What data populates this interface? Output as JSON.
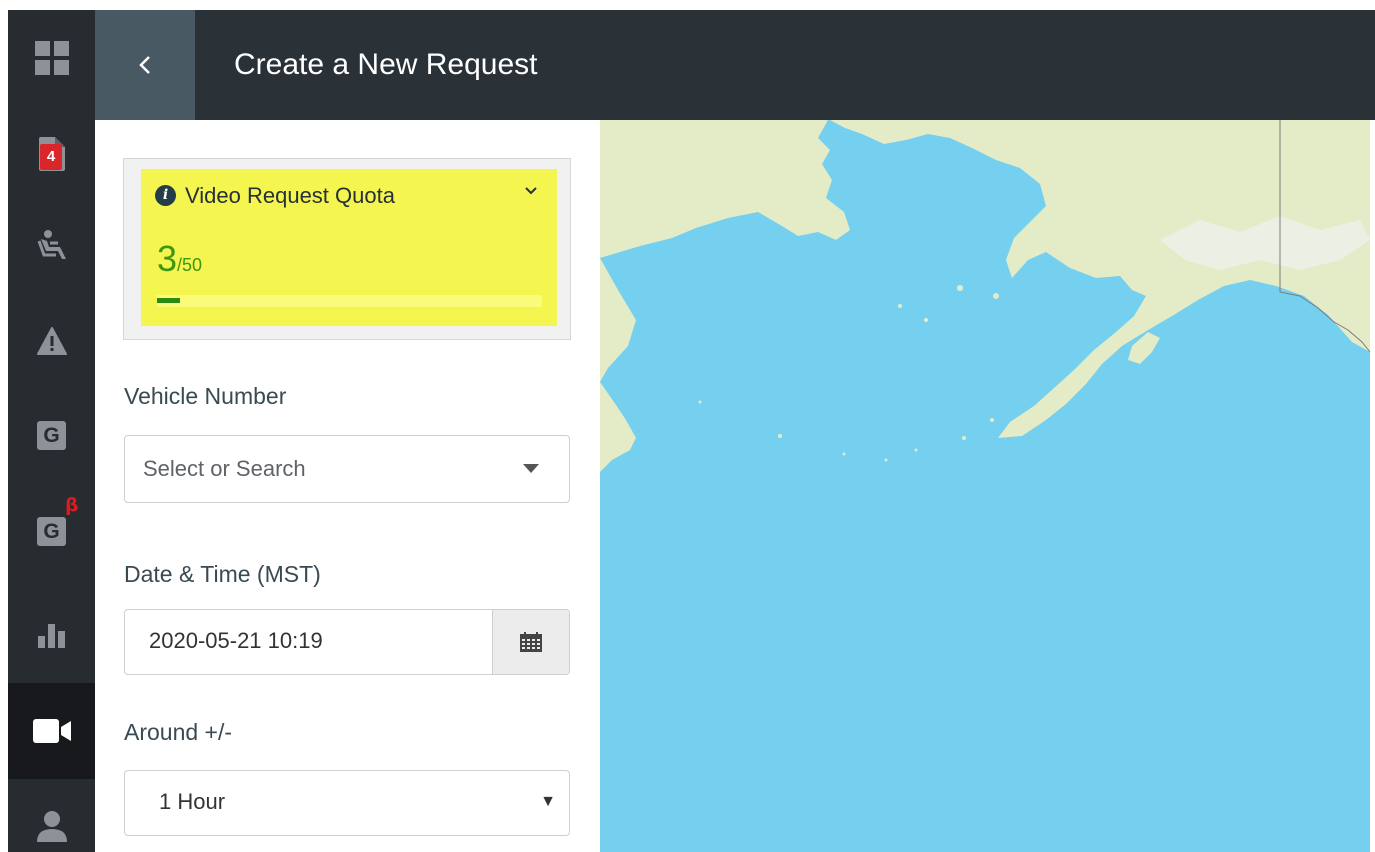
{
  "header": {
    "back_icon": "chevron-left-icon",
    "title": "Create a New Request"
  },
  "sidebar": {
    "items": [
      {
        "icon": "dashboard-grid-icon"
      },
      {
        "icon": "document-icon",
        "badge": "4"
      },
      {
        "icon": "driver-seat-icon"
      },
      {
        "icon": "warning-icon"
      },
      {
        "icon": "geofence-icon",
        "letter": "G"
      },
      {
        "icon": "geofence-beta-icon",
        "letter": "G",
        "superscript": "β"
      },
      {
        "icon": "bar-chart-icon"
      },
      {
        "icon": "video-camera-icon",
        "active": true
      },
      {
        "icon": "user-icon"
      }
    ]
  },
  "quota": {
    "title": "Video Request Quota",
    "used": "3",
    "total": "/50",
    "used_fraction": 0.06,
    "colors": {
      "background": "#f5f54f",
      "progress": "#2d8a10"
    }
  },
  "form": {
    "vehicle_label": "Vehicle Number",
    "vehicle_placeholder": "Select or Search",
    "datetime_label": "Date & Time (MST)",
    "datetime_value": "2020-05-21 10:19",
    "around_label": "Around +/-",
    "around_value": "1 Hour"
  },
  "map": {
    "water_color": "#75cfef",
    "land_color": "#e3ecc7"
  }
}
